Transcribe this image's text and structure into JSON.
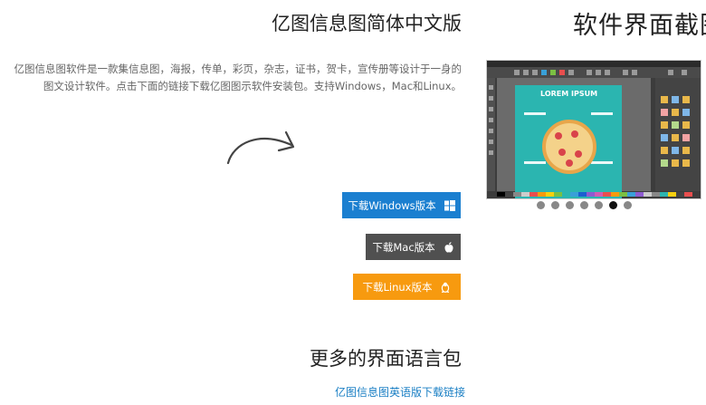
{
  "screenshot_section": {
    "title": "软件界面截图",
    "slide_text": "LOREM IPSUM",
    "slides": 7,
    "active_slide": 6
  },
  "edition": {
    "title": "亿图信息图简体中文版",
    "description": "亿图信息图软件是一款集信息图，海报，传单，彩页，杂志，证书，贺卡，宣传册等设计于一身的图文设计软件。点击下面的链接下载亿图图示软件安装包。支持Windows，Mac和Linux。"
  },
  "downloads": {
    "windows_label": "下载Windows版本",
    "mac_label": "下载Mac版本",
    "linux_label": "下载Linux版本"
  },
  "more_languages": {
    "title": "更多的界面语言包",
    "link": "亿图信息图英语版下载链接"
  },
  "colors": {
    "windows_button": "#1b7fd0",
    "mac_button": "#505050",
    "linux_button": "#f79a0f",
    "link": "#1a7fc4"
  },
  "icons": {
    "windows": "windows-icon",
    "mac": "apple-icon",
    "linux": "linux-penguin-icon",
    "arrow": "curved-arrow-icon"
  }
}
